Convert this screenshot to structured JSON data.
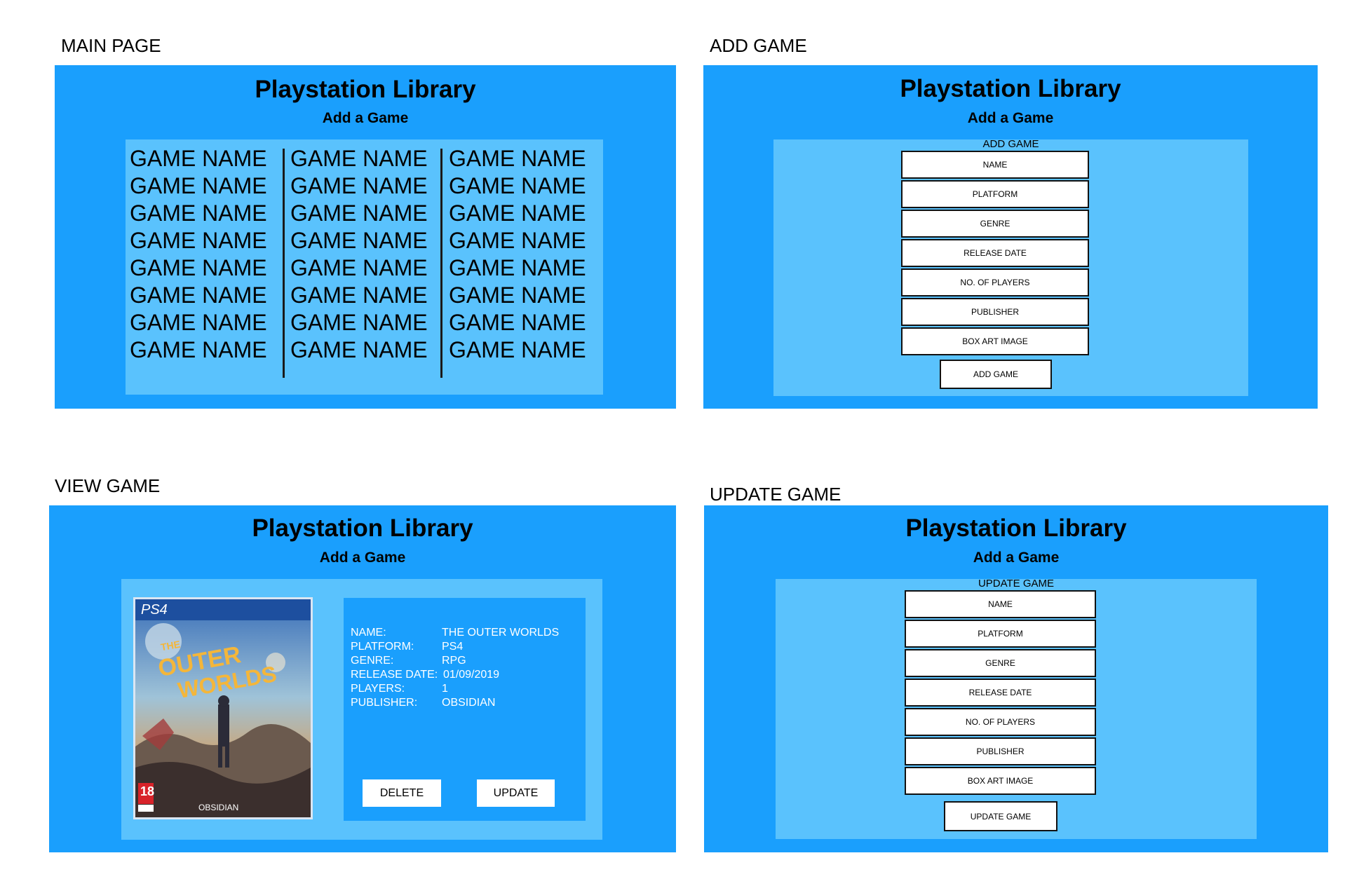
{
  "sections": {
    "main": "MAIN PAGE",
    "add": "ADD GAME",
    "view": "VIEW GAME",
    "update": "UPDATE GAME"
  },
  "app": {
    "title": "Playstation Library",
    "subtitle": "Add a Game"
  },
  "main_page": {
    "columns": [
      [
        "GAME NAME",
        "GAME NAME",
        "GAME NAME",
        "GAME NAME",
        "GAME NAME",
        "GAME NAME",
        "GAME NAME",
        "GAME NAME"
      ],
      [
        "GAME NAME",
        "GAME NAME",
        "GAME NAME",
        "GAME NAME",
        "GAME NAME",
        "GAME NAME",
        "GAME NAME",
        "GAME NAME"
      ],
      [
        "GAME NAME",
        "GAME NAME",
        "GAME NAME",
        "GAME NAME",
        "GAME NAME",
        "GAME NAME",
        "GAME NAME",
        "GAME NAME"
      ]
    ]
  },
  "add_form": {
    "caption": "ADD GAME",
    "fields": [
      "NAME",
      "PLATFORM",
      "GENRE",
      "RELEASE DATE",
      "NO. OF PLAYERS",
      "PUBLISHER",
      "BOX ART IMAGE"
    ],
    "submit": "ADD GAME"
  },
  "update_form": {
    "caption": "UPDATE GAME",
    "fields": [
      "NAME",
      "PLATFORM",
      "GENRE",
      "RELEASE DATE",
      "NO. OF PLAYERS",
      "PUBLISHER",
      "BOX ART IMAGE"
    ],
    "submit": "UPDATE GAME"
  },
  "view_game": {
    "boxart": {
      "platform": "PS4",
      "title_line1": "THE",
      "title_line2": "OUTER",
      "title_line3": "WORLDS",
      "rating": "18",
      "publisher_mark": "OBSIDIAN"
    },
    "details": [
      {
        "label": "NAME:",
        "value": "THE OUTER WORLDS"
      },
      {
        "label": "PLATFORM:",
        "value": "PS4"
      },
      {
        "label": "GENRE:",
        "value": "RPG"
      },
      {
        "label": "RELEASE DATE:",
        "value": "01/09/2019"
      },
      {
        "label": "PLAYERS:",
        "value": "1"
      },
      {
        "label": "PUBLISHER:",
        "value": "OBSIDIAN"
      }
    ],
    "delete_label": "DELETE",
    "update_label": "UPDATE"
  },
  "colors": {
    "panel": "#1a9ffd",
    "inner": "#5ac2fd"
  }
}
